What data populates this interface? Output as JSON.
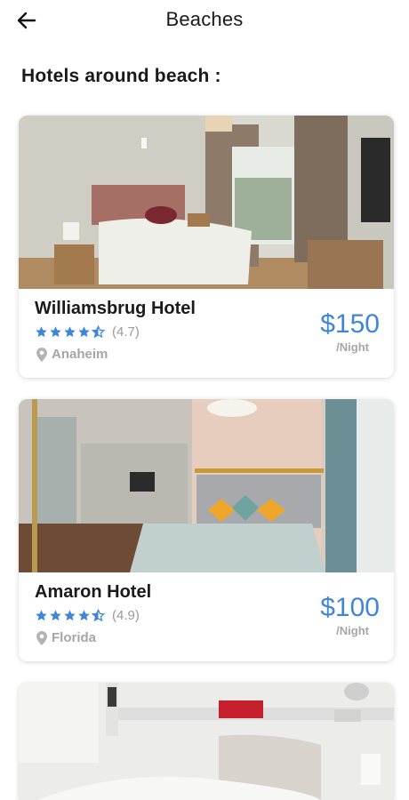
{
  "header": {
    "title": "Beaches",
    "back_icon": "arrow-left-icon"
  },
  "section_title": "Hotels around beach :",
  "colors": {
    "accent": "#3f86d9",
    "star": "#3f86d9",
    "muted": "#a6a6a6"
  },
  "hotels": [
    {
      "name": "Williamsbrug Hotel",
      "rating_text": "(4.7)",
      "stars": 4.5,
      "location": "Anaheim",
      "price": "$150",
      "per": "/Night"
    },
    {
      "name": "Amaron Hotel",
      "rating_text": "(4.9)",
      "stars": 4.5,
      "location": "Florida",
      "price": "$100",
      "per": "/Night"
    }
  ]
}
